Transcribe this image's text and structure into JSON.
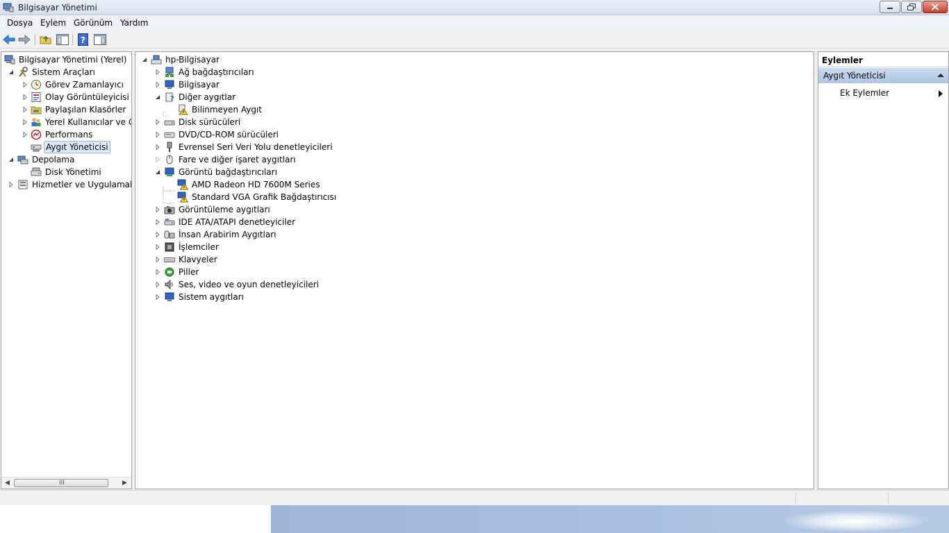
{
  "window": {
    "title": "Bilgisayar Yönetimi"
  },
  "menu": [
    "Dosya",
    "Eylem",
    "Görünüm",
    "Yardım"
  ],
  "left_tree": [
    {
      "label": "Bilgisayar Yönetimi (Yerel)",
      "icon": "computer-management-icon",
      "expander": "none"
    },
    {
      "label": "Sistem Araçları",
      "icon": "system-tools-icon",
      "expander": "expanded"
    },
    {
      "label": "Görev Zamanlayıcı",
      "icon": "clock-icon",
      "expander": "collapsed"
    },
    {
      "label": "Olay Görüntüleyicisi",
      "icon": "event-viewer-icon",
      "expander": "collapsed"
    },
    {
      "label": "Paylaşılan Klasörler",
      "icon": "shared-folder-icon",
      "expander": "collapsed"
    },
    {
      "label": "Yerel Kullanıcılar ve Gru",
      "icon": "users-icon",
      "expander": "collapsed"
    },
    {
      "label": "Performans",
      "icon": "performance-icon",
      "expander": "collapsed"
    },
    {
      "label": "Aygıt Yöneticisi",
      "icon": "device-manager-icon",
      "expander": "none",
      "selected": true
    },
    {
      "label": "Depolama",
      "icon": "storage-icon",
      "expander": "expanded"
    },
    {
      "label": "Disk Yönetimi",
      "icon": "disk-management-icon",
      "expander": "none"
    },
    {
      "label": "Hizmetler ve Uygulamalar",
      "icon": "services-icon",
      "expander": "collapsed"
    }
  ],
  "device_tree": [
    {
      "label": "hp-Bilgisayar",
      "icon": "computer-icon",
      "expander": "expanded"
    },
    {
      "label": "Ağ bağdaştırıcıları",
      "icon": "network-adapter-icon",
      "expander": "collapsed"
    },
    {
      "label": "Bilgisayar",
      "icon": "monitor-icon",
      "expander": "collapsed"
    },
    {
      "label": "Diğer aygıtlar",
      "icon": "unknown-device-icon",
      "expander": "expanded"
    },
    {
      "label": "Bilinmeyen Aygıt",
      "icon": "warning-device-icon",
      "expander": "none"
    },
    {
      "label": "Disk sürücüleri",
      "icon": "disk-drive-icon",
      "expander": "collapsed"
    },
    {
      "label": "DVD/CD-ROM sürücüleri",
      "icon": "dvd-drive-icon",
      "expander": "collapsed"
    },
    {
      "label": "Evrensel Seri Veri Yolu denetleyicileri",
      "icon": "usb-icon",
      "expander": "collapsed"
    },
    {
      "label": "Fare ve diğer işaret aygıtları",
      "icon": "mouse-icon",
      "expander": "collapsed"
    },
    {
      "label": "Görüntü bağdaştırıcıları",
      "icon": "display-adapter-icon",
      "expander": "expanded"
    },
    {
      "label": "AMD Radeon HD 7600M Series",
      "icon": "warning-display-icon",
      "expander": "none"
    },
    {
      "label": "Standard VGA Grafik Bağdaştırıcısı",
      "icon": "warning-display-icon",
      "expander": "none"
    },
    {
      "label": "Görüntüleme aygıtları",
      "icon": "camera-icon",
      "expander": "collapsed"
    },
    {
      "label": "IDE ATA/ATAPI denetleyiciler",
      "icon": "ide-controller-icon",
      "expander": "collapsed"
    },
    {
      "label": "İnsan Arabirim Aygıtları",
      "icon": "hid-icon",
      "expander": "collapsed"
    },
    {
      "label": "İşlemciler",
      "icon": "processor-icon",
      "expander": "collapsed"
    },
    {
      "label": "Klavyeler",
      "icon": "keyboard-icon",
      "expander": "collapsed"
    },
    {
      "label": "Piller",
      "icon": "battery-icon",
      "expander": "collapsed"
    },
    {
      "label": "Ses, video ve oyun denetleyicileri",
      "icon": "speaker-icon",
      "expander": "collapsed"
    },
    {
      "label": "Sistem aygıtları",
      "icon": "system-device-icon",
      "expander": "collapsed"
    }
  ],
  "actions": {
    "header": "Eylemler",
    "section": "Aygıt Yöneticisi",
    "items": [
      "Ek Eylemler"
    ]
  },
  "scrollbar": {
    "grip": "III"
  }
}
